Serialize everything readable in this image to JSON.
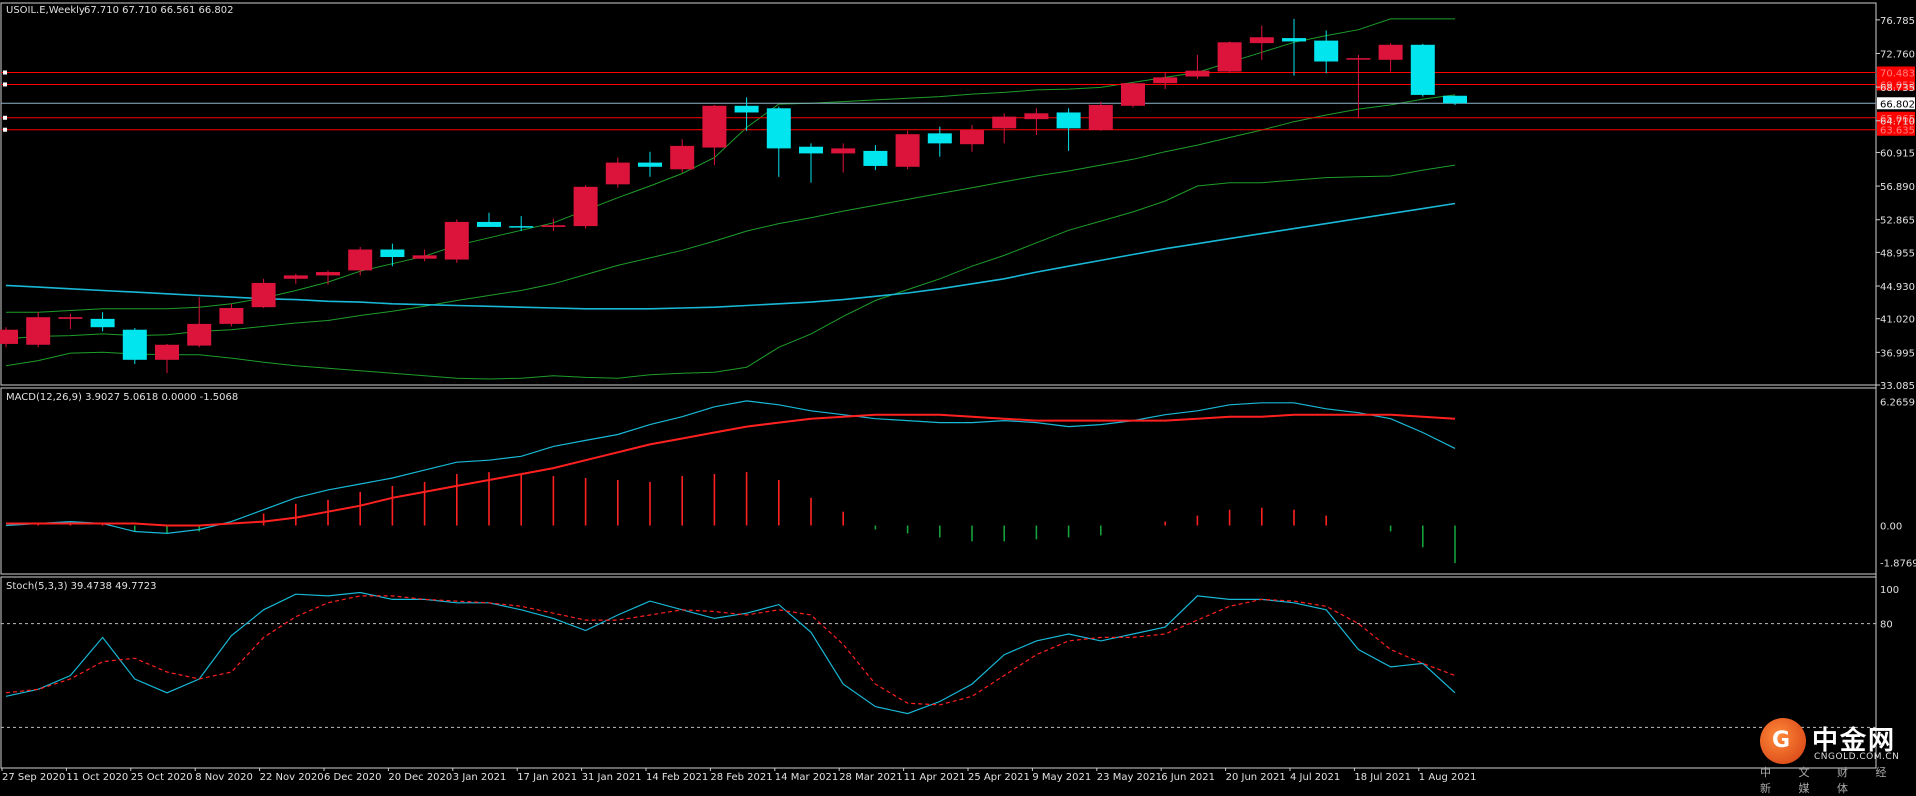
{
  "chart_data": [
    {
      "type": "candlestick",
      "title": "USOIL.E,Weekly",
      "ohlc_text": "67.710 67.710 66.561 66.802",
      "y_ticks": [
        "76.785",
        "72.760",
        "68.735",
        "64.710",
        "60.915",
        "56.890",
        "52.865",
        "48.955",
        "44.930",
        "41.020",
        "36.995",
        "33.085"
      ],
      "y_range": [
        33.085,
        78.8
      ],
      "x_labels": [
        "27 Sep 2020",
        "11 Oct 2020",
        "25 Oct 2020",
        "8 Nov 2020",
        "22 Nov 2020",
        "6 Dec 2020",
        "20 Dec 2020",
        "3 Jan 2021",
        "17 Jan 2021",
        "31 Jan 2021",
        "14 Feb 2021",
        "28 Feb 2021",
        "14 Mar 2021",
        "28 Mar 2021",
        "11 Apr 2021",
        "25 Apr 2021",
        "9 May 2021",
        "23 May 2021",
        "6 Jun 2021",
        "20 Jun 2021",
        "4 Jul 2021",
        "18 Jul 2021",
        "1 Aug 2021"
      ],
      "candles": [
        {
          "o": 38.0,
          "h": 40.0,
          "l": 37.6,
          "c": 39.7
        },
        {
          "o": 37.9,
          "h": 41.8,
          "l": 37.6,
          "c": 41.2
        },
        {
          "o": 41.0,
          "h": 41.6,
          "l": 39.8,
          "c": 41.2
        },
        {
          "o": 41.0,
          "h": 41.8,
          "l": 39.5,
          "c": 40.0
        },
        {
          "o": 39.7,
          "h": 39.9,
          "l": 35.6,
          "c": 36.1
        },
        {
          "o": 36.1,
          "h": 38.0,
          "l": 34.5,
          "c": 37.9
        },
        {
          "o": 37.8,
          "h": 43.6,
          "l": 37.6,
          "c": 40.4
        },
        {
          "o": 40.4,
          "h": 42.8,
          "l": 40.1,
          "c": 42.3
        },
        {
          "o": 42.4,
          "h": 45.8,
          "l": 42.3,
          "c": 45.3
        },
        {
          "o": 45.8,
          "h": 46.4,
          "l": 45.2,
          "c": 46.2
        },
        {
          "o": 46.2,
          "h": 46.8,
          "l": 45.1,
          "c": 46.6
        },
        {
          "o": 46.8,
          "h": 49.6,
          "l": 46.2,
          "c": 49.3
        },
        {
          "o": 49.3,
          "h": 50.0,
          "l": 47.3,
          "c": 48.4
        },
        {
          "o": 48.2,
          "h": 49.3,
          "l": 47.9,
          "c": 48.6
        },
        {
          "o": 48.1,
          "h": 52.9,
          "l": 47.7,
          "c": 52.6
        },
        {
          "o": 52.6,
          "h": 53.7,
          "l": 52.0,
          "c": 52.0
        },
        {
          "o": 52.1,
          "h": 53.3,
          "l": 51.5,
          "c": 52.0
        },
        {
          "o": 52.0,
          "h": 53.0,
          "l": 51.5,
          "c": 52.2
        },
        {
          "o": 52.1,
          "h": 57.0,
          "l": 51.8,
          "c": 56.8
        },
        {
          "o": 57.1,
          "h": 60.3,
          "l": 56.7,
          "c": 59.7
        },
        {
          "o": 59.7,
          "h": 61.0,
          "l": 58.0,
          "c": 59.2
        },
        {
          "o": 58.9,
          "h": 62.5,
          "l": 58.5,
          "c": 61.7
        },
        {
          "o": 61.5,
          "h": 66.6,
          "l": 59.4,
          "c": 66.5
        },
        {
          "o": 66.5,
          "h": 67.5,
          "l": 63.5,
          "c": 65.7
        },
        {
          "o": 66.2,
          "h": 66.4,
          "l": 58.0,
          "c": 61.4
        },
        {
          "o": 61.6,
          "h": 62.0,
          "l": 57.3,
          "c": 60.8
        },
        {
          "o": 60.8,
          "h": 62.0,
          "l": 58.5,
          "c": 61.4
        },
        {
          "o": 61.1,
          "h": 61.8,
          "l": 58.8,
          "c": 59.3
        },
        {
          "o": 59.2,
          "h": 63.5,
          "l": 58.9,
          "c": 63.1
        },
        {
          "o": 63.2,
          "h": 64.0,
          "l": 60.4,
          "c": 62.0
        },
        {
          "o": 61.9,
          "h": 64.2,
          "l": 61.0,
          "c": 63.6
        },
        {
          "o": 63.8,
          "h": 65.6,
          "l": 62.0,
          "c": 65.2
        },
        {
          "o": 64.9,
          "h": 66.2,
          "l": 63.0,
          "c": 65.6
        },
        {
          "o": 65.7,
          "h": 66.2,
          "l": 61.1,
          "c": 63.8
        },
        {
          "o": 63.6,
          "h": 67.0,
          "l": 63.5,
          "c": 66.6
        },
        {
          "o": 66.5,
          "h": 69.3,
          "l": 66.3,
          "c": 69.2
        },
        {
          "o": 69.2,
          "h": 70.5,
          "l": 68.5,
          "c": 69.9
        },
        {
          "o": 70.0,
          "h": 72.6,
          "l": 69.7,
          "c": 70.7
        },
        {
          "o": 70.6,
          "h": 74.2,
          "l": 70.4,
          "c": 74.1
        },
        {
          "o": 74.0,
          "h": 76.1,
          "l": 72.0,
          "c": 74.7
        },
        {
          "o": 74.6,
          "h": 76.9,
          "l": 70.1,
          "c": 74.2
        },
        {
          "o": 74.3,
          "h": 75.5,
          "l": 70.4,
          "c": 71.8
        },
        {
          "o": 72.2,
          "h": 72.6,
          "l": 65.0,
          "c": 72.2
        },
        {
          "o": 72.0,
          "h": 74.0,
          "l": 70.6,
          "c": 73.8
        },
        {
          "o": 73.8,
          "h": 73.9,
          "l": 67.6,
          "c": 67.8
        },
        {
          "o": 67.7,
          "h": 67.7,
          "l": 66.6,
          "c": 66.8
        }
      ],
      "horizontal_lines": [
        {
          "value": 70.483,
          "label": "70.483",
          "color": "#ff0000"
        },
        {
          "value": 69.053,
          "label": "69.053",
          "color": "#ff0000"
        },
        {
          "value": 66.802,
          "label": "66.802",
          "color": "#8fb3c9"
        },
        {
          "value": 65.065,
          "label": "65.065",
          "color": "#ff0000"
        },
        {
          "value": 63.635,
          "label": "63.635",
          "color": "#ff0000"
        }
      ],
      "bollinger_upper": [
        41.8,
        41.8,
        42.0,
        42.2,
        42.2,
        42.2,
        42.4,
        42.8,
        43.5,
        44.4,
        45.4,
        46.7,
        47.6,
        48.5,
        49.8,
        50.7,
        51.6,
        52.5,
        54.0,
        55.5,
        56.9,
        58.4,
        60.3,
        63.9,
        66.7,
        66.8,
        67.0,
        67.2,
        67.4,
        67.6,
        67.9,
        68.1,
        68.4,
        68.5,
        68.7,
        69.3,
        69.9,
        70.5,
        71.7,
        72.9,
        74.1,
        74.9,
        75.6,
        76.9,
        76.9,
        76.9
      ],
      "bollinger_middle": [
        38.6,
        38.9,
        39.0,
        39.2,
        39.0,
        39.1,
        39.5,
        39.7,
        40.1,
        40.5,
        40.8,
        41.4,
        41.9,
        42.5,
        43.2,
        43.8,
        44.4,
        45.2,
        46.3,
        47.4,
        48.3,
        49.2,
        50.3,
        51.5,
        52.4,
        53.1,
        53.9,
        54.6,
        55.3,
        56.0,
        56.7,
        57.4,
        58.1,
        58.7,
        59.4,
        60.1,
        61.0,
        61.8,
        62.7,
        63.6,
        64.6,
        65.4,
        66.1,
        66.6,
        67.3,
        67.8
      ],
      "bollinger_lower": [
        35.4,
        36.0,
        36.9,
        37.0,
        36.8,
        36.7,
        36.7,
        36.3,
        35.8,
        35.4,
        35.1,
        34.8,
        34.5,
        34.2,
        33.9,
        33.8,
        33.9,
        34.2,
        34.0,
        33.9,
        34.3,
        34.5,
        34.6,
        35.2,
        37.6,
        39.2,
        41.3,
        43.2,
        44.5,
        45.8,
        47.3,
        48.6,
        50.1,
        51.6,
        52.7,
        53.8,
        55.1,
        56.9,
        57.3,
        57.3,
        57.6,
        57.9,
        58.0,
        58.1,
        58.8,
        59.4
      ],
      "ma_long": [
        45.0,
        44.8,
        44.6,
        44.4,
        44.2,
        44.0,
        43.8,
        43.6,
        43.4,
        43.3,
        43.1,
        43.0,
        42.8,
        42.7,
        42.6,
        42.5,
        42.4,
        42.3,
        42.2,
        42.2,
        42.2,
        42.3,
        42.4,
        42.6,
        42.8,
        43.0,
        43.3,
        43.7,
        44.1,
        44.6,
        45.2,
        45.8,
        46.6,
        47.3,
        48.0,
        48.7,
        49.4,
        50.0,
        50.6,
        51.2,
        51.8,
        52.4,
        53.0,
        53.6,
        54.2,
        54.8
      ]
    },
    {
      "type": "macd",
      "label": "MACD(12,26,9) 3.9027 5.0618 0.0000 -1.5068",
      "y_ticks": [
        "6.2659",
        "0.00",
        "-1.8769"
      ],
      "y_range": [
        -2.45,
        6.95
      ],
      "histogram": [
        0.0,
        0.1,
        0.2,
        0.1,
        -0.3,
        -0.4,
        -0.3,
        0.0,
        0.6,
        1.1,
        1.3,
        1.7,
        2.0,
        2.2,
        2.6,
        2.7,
        2.6,
        2.5,
        2.4,
        2.3,
        2.2,
        2.5,
        2.6,
        2.7,
        2.3,
        1.4,
        0.7,
        -0.2,
        -0.4,
        -0.6,
        -0.8,
        -0.8,
        -0.7,
        -0.6,
        -0.5,
        0.0,
        0.2,
        0.5,
        0.8,
        0.9,
        0.8,
        0.5,
        0.0,
        -0.3,
        -1.1,
        -1.9
      ],
      "macd_line": [
        0.0,
        0.1,
        0.2,
        0.1,
        -0.3,
        -0.4,
        -0.2,
        0.2,
        0.8,
        1.4,
        1.8,
        2.1,
        2.4,
        2.8,
        3.2,
        3.3,
        3.5,
        4.0,
        4.3,
        4.6,
        5.1,
        5.5,
        6.0,
        6.3,
        6.1,
        5.8,
        5.6,
        5.4,
        5.3,
        5.2,
        5.2,
        5.3,
        5.2,
        5.0,
        5.1,
        5.3,
        5.6,
        5.8,
        6.1,
        6.2,
        6.2,
        5.9,
        5.7,
        5.4,
        4.7,
        3.9
      ],
      "signal_line": [
        0.1,
        0.1,
        0.1,
        0.1,
        0.1,
        0.0,
        0.0,
        0.1,
        0.2,
        0.4,
        0.7,
        1.0,
        1.4,
        1.7,
        2.0,
        2.3,
        2.6,
        2.9,
        3.3,
        3.7,
        4.1,
        4.4,
        4.7,
        5.0,
        5.2,
        5.4,
        5.5,
        5.6,
        5.6,
        5.6,
        5.5,
        5.4,
        5.3,
        5.3,
        5.3,
        5.3,
        5.3,
        5.4,
        5.5,
        5.5,
        5.6,
        5.6,
        5.6,
        5.6,
        5.5,
        5.4
      ]
    },
    {
      "type": "stochastic",
      "label": "Stoch(5,3,3) 39.4738 49.7723",
      "y_ticks": [
        "100",
        "80"
      ],
      "y_range": [
        0,
        100
      ],
      "dotted_levels": [
        80,
        20
      ],
      "main": [
        38,
        42,
        50,
        72,
        48,
        40,
        48,
        73,
        88,
        97,
        96,
        98,
        94,
        94,
        92,
        92,
        88,
        83,
        76,
        85,
        93,
        88,
        83,
        86,
        91,
        75,
        45,
        32,
        28,
        35,
        45,
        62,
        70,
        74,
        70,
        74,
        78,
        96,
        94,
        94,
        92,
        88,
        65,
        55,
        57,
        40
      ],
      "signal": [
        40,
        42,
        48,
        58,
        60,
        52,
        48,
        52,
        72,
        84,
        92,
        96,
        96,
        94,
        93,
        92,
        90,
        86,
        82,
        82,
        85,
        88,
        87,
        85,
        88,
        85,
        68,
        45,
        34,
        33,
        38,
        50,
        62,
        70,
        72,
        72,
        74,
        82,
        90,
        94,
        93,
        90,
        80,
        65,
        57,
        50
      ]
    }
  ],
  "watermark": {
    "brand": "中金网",
    "domain": "CNGOLD.COM.CN",
    "tagline": "中 文 财 经 新 媒 体"
  },
  "colors": {
    "bull": "#dc143c",
    "bear": "#00e5ee",
    "boll": "#1e9e2a",
    "ma": "#18b8d6",
    "macd_signal": "#ff2020",
    "hist_up": "#ff2020",
    "hist_down": "#13a13a",
    "stoch_main": "#18b8d6",
    "stoch_signal": "#ff2020"
  }
}
